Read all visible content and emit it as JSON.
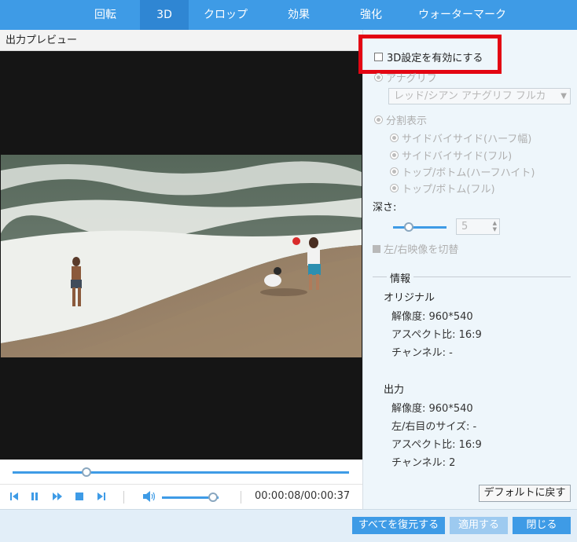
{
  "tabs": [
    {
      "label": "回転"
    },
    {
      "label": "3D"
    },
    {
      "label": "クロップ"
    },
    {
      "label": "効果"
    },
    {
      "label": "強化"
    },
    {
      "label": "ウォーターマーク"
    }
  ],
  "preview": {
    "title": "出力プレビュー",
    "seek_progress": 0.22,
    "volume_level": 0.9,
    "time": "00:00:08/00:00:37"
  },
  "settings": {
    "enable_3d_label": "3D設定を有効にする",
    "enable_3d_checked": false,
    "anaglyph_label": "アナグリフ",
    "anaglyph_select_value": "レッド/シアン アナグリフ フルカ",
    "split_label": "分割表示",
    "split_options": [
      "サイドバイサイド(ハーフ幅)",
      "サイドバイサイド(フル)",
      "トップ/ボトム(ハーフハイト)",
      "トップ/ボトム(フル)"
    ],
    "depth_label": "深さ:",
    "depth_value": "5",
    "swap_label": "左/右映像を切替"
  },
  "info": {
    "title": "情報",
    "original_heading": "オリジナル",
    "original": {
      "resolution": "解像度: 960*540",
      "aspect": "アスペクト比: 16:9",
      "channel": "チャンネル: -"
    },
    "output_heading": "出力",
    "output": {
      "resolution": "解像度: 960*540",
      "lr_size": "左/右目のサイズ: -",
      "aspect": "アスペクト比: 16:9",
      "channel": "チャンネル: 2"
    }
  },
  "buttons": {
    "default": "デフォルトに戻す",
    "restore_all": "すべてを復元する",
    "apply": "適用する",
    "close": "閉じる"
  },
  "colors": {
    "accent": "#3e9be6",
    "highlight": "#e30613"
  }
}
